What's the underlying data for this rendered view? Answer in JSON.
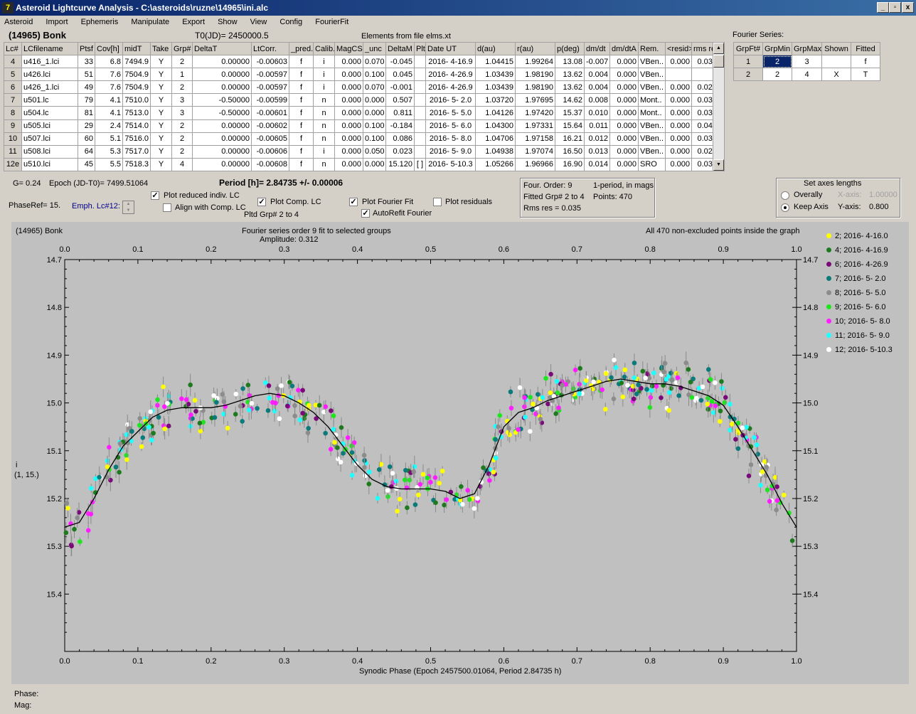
{
  "window": {
    "title": "Asteroid Lightcurve Analysis - C:\\asteroids\\ruzne\\14965\\ini.alc",
    "icon": "app-icon",
    "min": "_",
    "max": "▫",
    "close": "x"
  },
  "menu": [
    "Asteroid",
    "Import",
    "Ephemeris",
    "Manipulate",
    "Export",
    "Show",
    "View",
    "Config",
    "FourierFit"
  ],
  "header": {
    "asteroid": "(14965) Bonk",
    "t0": "T0(JD)= 2450000.5",
    "elements": "Elements from file elms.xt",
    "fourier_label": "Fourier Series:"
  },
  "table": {
    "columns": [
      "Lc#",
      "LCfilename",
      "Ptsf",
      "Cov[h]",
      "midT",
      "Take",
      "Grp#",
      "DeltaT",
      "LtCorr.",
      "_pred.",
      "Calib.",
      "MagCS",
      "_unc",
      "DeltaM",
      "Plt",
      "Date UT",
      "d(au)",
      "r(au)",
      "p(deg)",
      "dm/dt",
      "dm/dtA",
      "Rem.",
      "<resid>",
      "rms res"
    ],
    "rows": [
      [
        "4",
        "u416_1.lci",
        "33",
        "6.8",
        "7494.9",
        "Y",
        "2",
        "0.00000",
        "-0.00603",
        "f",
        "i",
        "0.000",
        "0.070",
        "-0.045",
        "",
        "2016- 4-16.9",
        "1.04415",
        "1.99264",
        "13.08",
        "-0.007",
        "0.000",
        "VBen..",
        "0.000",
        "0.036"
      ],
      [
        "5",
        "u426.lci",
        "51",
        "7.6",
        "7504.9",
        "Y",
        "1",
        "0.00000",
        "-0.00597",
        "f",
        "i",
        "0.000",
        "0.100",
        "0.045",
        "",
        "2016- 4-26.9",
        "1.03439",
        "1.98190",
        "13.62",
        "0.004",
        "0.000",
        "VBen..",
        "",
        ""
      ],
      [
        "6",
        "u426_1.lci",
        "49",
        "7.6",
        "7504.9",
        "Y",
        "2",
        "0.00000",
        "-0.00597",
        "f",
        "i",
        "0.000",
        "0.070",
        "-0.001",
        "",
        "2016- 4-26.9",
        "1.03439",
        "1.98190",
        "13.62",
        "0.004",
        "0.000",
        "VBen..",
        "0.000",
        "0.027"
      ],
      [
        "7",
        "u501.lc",
        "79",
        "4.1",
        "7510.0",
        "Y",
        "3",
        "-0.50000",
        "-0.00599",
        "f",
        "n",
        "0.000",
        "0.000",
        "0.507",
        "",
        "2016- 5- 2.0",
        "1.03720",
        "1.97695",
        "14.62",
        "0.008",
        "0.000",
        "Mont..",
        "0.000",
        "0.038"
      ],
      [
        "8",
        "u504.lc",
        "81",
        "4.1",
        "7513.0",
        "Y",
        "3",
        "-0.50000",
        "-0.00601",
        "f",
        "n",
        "0.000",
        "0.000",
        "0.811",
        "",
        "2016- 5- 5.0",
        "1.04126",
        "1.97420",
        "15.37",
        "0.010",
        "0.000",
        "Mont..",
        "0.000",
        "0.034"
      ],
      [
        "9",
        "u505.lci",
        "29",
        "2.4",
        "7514.0",
        "Y",
        "2",
        "0.00000",
        "-0.00602",
        "f",
        "n",
        "0.000",
        "0.100",
        "-0.184",
        "",
        "2016- 5- 6.0",
        "1.04300",
        "1.97331",
        "15.64",
        "0.011",
        "0.000",
        "VBen..",
        "0.000",
        "0.041"
      ],
      [
        "10",
        "u507.lci",
        "60",
        "5.1",
        "7516.0",
        "Y",
        "2",
        "0.00000",
        "-0.00605",
        "f",
        "n",
        "0.000",
        "0.100",
        "0.086",
        "",
        "2016- 5- 8.0",
        "1.04706",
        "1.97158",
        "16.21",
        "0.012",
        "0.000",
        "VBen..",
        "0.000",
        "0.032"
      ],
      [
        "11",
        "u508.lci",
        "64",
        "5.3",
        "7517.0",
        "Y",
        "2",
        "0.00000",
        "-0.00606",
        "f",
        "i",
        "0.000",
        "0.050",
        "0.023",
        "",
        "2016- 5- 9.0",
        "1.04938",
        "1.97074",
        "16.50",
        "0.013",
        "0.000",
        "VBen..",
        "0.000",
        "0.028"
      ],
      [
        "12e",
        "u510.lci",
        "45",
        "5.5",
        "7518.3",
        "Y",
        "4",
        "0.00000",
        "-0.00608",
        "f",
        "n",
        "0.000",
        "0.000",
        "15.120",
        "[ ]",
        "2016- 5-10.3",
        "1.05266",
        "1.96966",
        "16.90",
        "0.014",
        "0.000",
        "SRO",
        "0.000",
        "0.036"
      ]
    ]
  },
  "fourier_table": {
    "columns": [
      "GrpFt#",
      "GrpMin",
      "GrpMax",
      "Shown",
      "Fitted"
    ],
    "rows": [
      [
        "1",
        "2",
        "3",
        "",
        "f"
      ],
      [
        "2",
        "2",
        "4",
        "X",
        "T"
      ]
    ]
  },
  "info": {
    "g": "G= 0.24",
    "epoch": "Epoch (JD-T0)= 7499.51064",
    "period": "Period [h]= 2.84735 +/- 0.00006",
    "phaseref": "PhaseRef= 15.",
    "emph": "Emph. Lc#12:",
    "plot_reduced": "Plot reduced indiv. LC",
    "align": "Align with Comp. LC",
    "plot_comp": "Plot Comp. LC",
    "pltd": "Pltd Grp#  2   to   4",
    "plot_fourier": "Plot Fourier Fit",
    "autorefit": "AutoRefit Fourier",
    "plot_resid": "Plot residuals",
    "four_order": "Four. Order:  9",
    "one_period": "1-period, in mags",
    "fitted": "Fitted Grp# 2 to 4",
    "points": "Points: 470",
    "rms": "Rms res     = 0.035",
    "axes_title": "Set axes lengths",
    "overally": "Overally",
    "keep_axis": "Keep Axis",
    "xaxis_label": "X-axis:",
    "xaxis_val": "1.00000",
    "yaxis_label": "Y-axis:",
    "yaxis_val": "0.800"
  },
  "plot": {
    "name": "(14965) Bonk",
    "subtitle1": "Fourier series order 9 fit to selected groups",
    "subtitle2": "Amplitude: 0.312",
    "note": "All 470 non-excluded points inside the graph",
    "ylabel1": "i",
    "ylabel2": "(1, 15.)",
    "xlabel": "Synodic Phase (Epoch 2457500.01064, Period 2.84735 h)"
  },
  "status": {
    "phase": "Phase:",
    "mag": "Mag:"
  },
  "chart_data": {
    "type": "scatter",
    "x_ticks": [
      "0.0",
      "0.1",
      "0.2",
      "0.3",
      "0.4",
      "0.5",
      "0.6",
      "0.7",
      "0.8",
      "0.9",
      "1.0"
    ],
    "y_ticks": [
      "14.7",
      "14.8",
      "14.9",
      "15.0",
      "15.1",
      "15.2",
      "15.3",
      "15.4"
    ],
    "xlim": [
      0,
      1
    ],
    "ylim": [
      15.52,
      14.7
    ],
    "fit_curve": {
      "x": [
        0.0,
        0.02,
        0.04,
        0.06,
        0.08,
        0.1,
        0.12,
        0.14,
        0.16,
        0.18,
        0.2,
        0.22,
        0.24,
        0.26,
        0.28,
        0.3,
        0.32,
        0.34,
        0.36,
        0.38,
        0.4,
        0.42,
        0.44,
        0.46,
        0.48,
        0.5,
        0.52,
        0.54,
        0.56,
        0.58,
        0.6,
        0.62,
        0.64,
        0.66,
        0.68,
        0.7,
        0.72,
        0.74,
        0.76,
        0.78,
        0.8,
        0.82,
        0.84,
        0.86,
        0.88,
        0.9,
        0.92,
        0.94,
        0.96,
        0.98,
        1.0
      ],
      "y": [
        15.26,
        15.25,
        15.2,
        15.14,
        15.09,
        15.06,
        15.03,
        15.015,
        15.01,
        15.01,
        15.01,
        15.005,
        14.995,
        14.985,
        14.98,
        14.985,
        15.0,
        15.02,
        15.05,
        15.09,
        15.13,
        15.16,
        15.175,
        15.18,
        15.18,
        15.18,
        15.185,
        15.2,
        15.19,
        15.13,
        15.05,
        15.02,
        15.01,
        14.995,
        14.985,
        14.975,
        14.965,
        14.955,
        14.95,
        14.955,
        14.96,
        14.96,
        14.965,
        14.975,
        14.985,
        15.005,
        15.05,
        15.1,
        15.15,
        15.21,
        15.26
      ]
    },
    "series": [
      {
        "name": "2; 2016- 4-16.0",
        "color": "#ffff00"
      },
      {
        "name": "4; 2016- 4-16.9",
        "color": "#1e7a1e"
      },
      {
        "name": "6; 2016- 4-26.9",
        "color": "#7a0a7a"
      },
      {
        "name": "7; 2016- 5- 2.0",
        "color": "#0a7a7a"
      },
      {
        "name": "8; 2016- 5- 5.0",
        "color": "#8c8c8c"
      },
      {
        "name": "9; 2016- 5- 6.0",
        "color": "#1ee61e"
      },
      {
        "name": "10; 2016- 5- 8.0",
        "color": "#ff1eff"
      },
      {
        "name": "11; 2016- 5- 9.0",
        "color": "#1effff"
      },
      {
        "name": "12; 2016- 5-10.3",
        "color": "#ffffff"
      }
    ]
  }
}
